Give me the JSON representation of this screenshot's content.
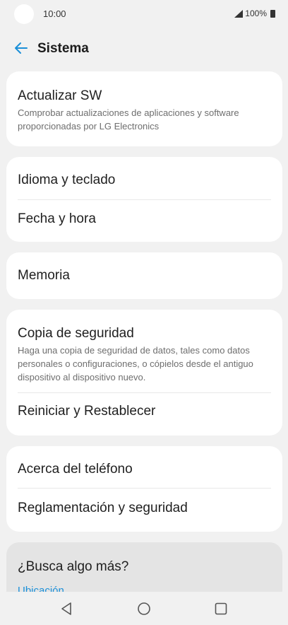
{
  "status_bar": {
    "time": "10:00",
    "battery": "100%"
  },
  "header": {
    "title": "Sistema"
  },
  "cards": [
    {
      "items": [
        {
          "label": "Actualizar SW",
          "subtitle": "Comprobar actualizaciones de aplicaciones y software proporcionadas por LG Electronics"
        }
      ]
    },
    {
      "items": [
        {
          "label": "Idioma y teclado"
        },
        {
          "label": "Fecha y hora"
        }
      ]
    },
    {
      "items": [
        {
          "label": "Memoria"
        }
      ]
    },
    {
      "items": [
        {
          "label": "Copia de seguridad",
          "subtitle": "Haga una copia de seguridad de datos, tales como datos personales o configuraciones, o cópielos desde el antiguo dispositivo al dispositivo nuevo."
        },
        {
          "label": "Reiniciar y Restablecer"
        }
      ]
    },
    {
      "items": [
        {
          "label": "Acerca del teléfono"
        },
        {
          "label": "Reglamentación y seguridad"
        }
      ]
    }
  ],
  "search_more": {
    "title": "¿Busca algo más?",
    "link": "Ubicación"
  },
  "colors": {
    "accent": "#1a8fd8",
    "background": "#f1f1f1",
    "card": "#ffffff"
  },
  "icons": {
    "back": "arrow-left-icon",
    "nav_back": "triangle-back-icon",
    "nav_home": "circle-home-icon",
    "nav_recents": "square-recents-icon"
  }
}
